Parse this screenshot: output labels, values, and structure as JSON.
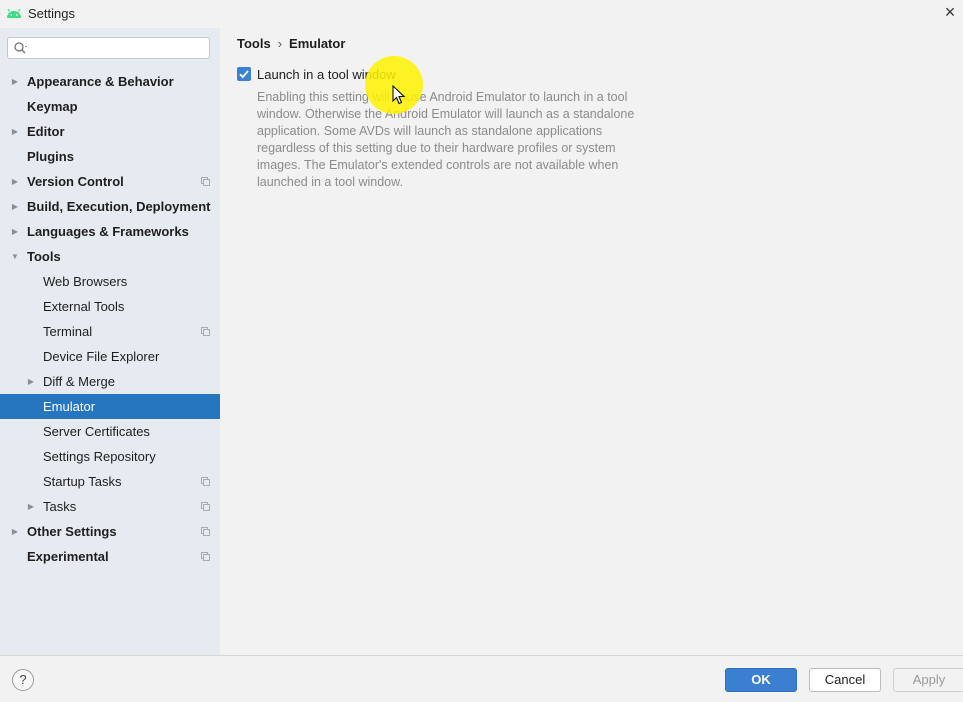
{
  "window": {
    "title": "Settings",
    "close_symbol": "×"
  },
  "search": {
    "placeholder": "",
    "value": ""
  },
  "sidebar": {
    "items": [
      {
        "label": "Appearance & Behavior",
        "level": 0,
        "expandable": true,
        "expanded": false,
        "bold": true,
        "project_icon": false,
        "selected": false
      },
      {
        "label": "Keymap",
        "level": 0,
        "expandable": false,
        "bold": true,
        "project_icon": false,
        "selected": false
      },
      {
        "label": "Editor",
        "level": 0,
        "expandable": true,
        "expanded": false,
        "bold": true,
        "project_icon": false,
        "selected": false
      },
      {
        "label": "Plugins",
        "level": 0,
        "expandable": false,
        "bold": true,
        "project_icon": false,
        "selected": false
      },
      {
        "label": "Version Control",
        "level": 0,
        "expandable": true,
        "expanded": false,
        "bold": true,
        "project_icon": true,
        "selected": false
      },
      {
        "label": "Build, Execution, Deployment",
        "level": 0,
        "expandable": true,
        "expanded": false,
        "bold": true,
        "project_icon": false,
        "selected": false
      },
      {
        "label": "Languages & Frameworks",
        "level": 0,
        "expandable": true,
        "expanded": false,
        "bold": true,
        "project_icon": false,
        "selected": false
      },
      {
        "label": "Tools",
        "level": 0,
        "expandable": true,
        "expanded": true,
        "bold": true,
        "project_icon": false,
        "selected": false
      },
      {
        "label": "Web Browsers",
        "level": 1,
        "expandable": false,
        "bold": false,
        "project_icon": false,
        "selected": false
      },
      {
        "label": "External Tools",
        "level": 1,
        "expandable": false,
        "bold": false,
        "project_icon": false,
        "selected": false
      },
      {
        "label": "Terminal",
        "level": 1,
        "expandable": false,
        "bold": false,
        "project_icon": true,
        "selected": false
      },
      {
        "label": "Device File Explorer",
        "level": 1,
        "expandable": false,
        "bold": false,
        "project_icon": false,
        "selected": false
      },
      {
        "label": "Diff & Merge",
        "level": 1,
        "expandable": true,
        "expanded": false,
        "bold": false,
        "project_icon": false,
        "selected": false
      },
      {
        "label": "Emulator",
        "level": 1,
        "expandable": false,
        "bold": false,
        "project_icon": false,
        "selected": true
      },
      {
        "label": "Server Certificates",
        "level": 1,
        "expandable": false,
        "bold": false,
        "project_icon": false,
        "selected": false
      },
      {
        "label": "Settings Repository",
        "level": 1,
        "expandable": false,
        "bold": false,
        "project_icon": false,
        "selected": false
      },
      {
        "label": "Startup Tasks",
        "level": 1,
        "expandable": false,
        "bold": false,
        "project_icon": true,
        "selected": false
      },
      {
        "label": "Tasks",
        "level": 1,
        "expandable": true,
        "expanded": false,
        "bold": false,
        "project_icon": true,
        "selected": false
      },
      {
        "label": "Other Settings",
        "level": 0,
        "expandable": true,
        "expanded": false,
        "bold": true,
        "project_icon": true,
        "selected": false
      },
      {
        "label": "Experimental",
        "level": 0,
        "expandable": false,
        "bold": true,
        "project_icon": true,
        "selected": false
      }
    ]
  },
  "breadcrumb": {
    "parent": "Tools",
    "separator": "›",
    "current": "Emulator"
  },
  "option": {
    "label": "Launch in a tool window",
    "checked": true,
    "description": "Enabling this setting will cause Android Emulator to launch in a tool window. Otherwise the Android Emulator will launch as a standalone application. Some AVDs will launch as standalone applications regardless of this setting due to their hardware profiles or system images. The Emulator's extended controls are not available when launched in a tool window."
  },
  "footer": {
    "help_label": "?",
    "ok_label": "OK",
    "cancel_label": "Cancel",
    "apply_label": "Apply"
  },
  "colors": {
    "accent": "#2675bf",
    "sidebar_bg": "#e6ebf1",
    "android_green": "#3ddc84",
    "highlight": "#fff200"
  },
  "icons": {
    "app": "android-icon",
    "search": "search-icon",
    "close": "close-icon",
    "expand": "chevron-right-icon",
    "collapse": "chevron-down-icon",
    "project": "project-level-icon",
    "check": "check-icon",
    "cursor": "mouse-pointer-icon",
    "help": "help-icon"
  }
}
